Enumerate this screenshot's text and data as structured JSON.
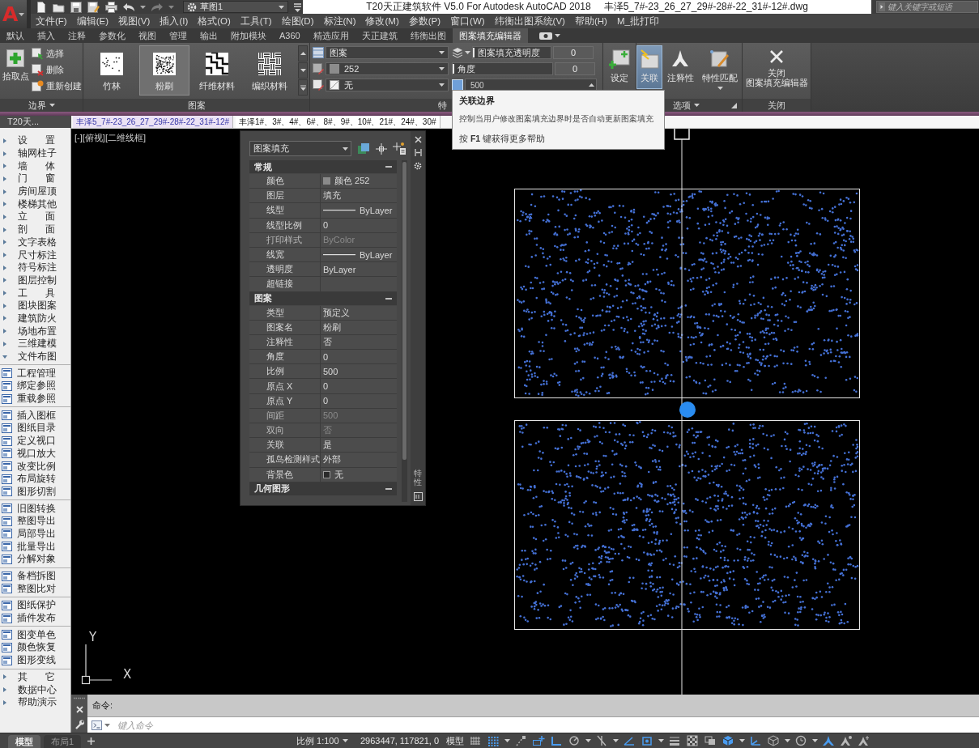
{
  "app_logo": "A",
  "workspace": "草图1",
  "window_title": "T20天正建筑软件 V5.0 For Autodesk AutoCAD 2018",
  "document_name": "丰泽5_7#-23_26_27_29#-28#-22_31#-12#.dwg",
  "search": {
    "placeholder": "键入关键字或短语"
  },
  "menu": [
    "文件(F)",
    "编辑(E)",
    "视图(V)",
    "插入(I)",
    "格式(O)",
    "工具(T)",
    "绘图(D)",
    "标注(N)",
    "修改(M)",
    "参数(P)",
    "窗口(W)",
    "纬衡出图系统(V)",
    "帮助(H)",
    "M_批打印"
  ],
  "ribbon_tabs": [
    {
      "label": "默认",
      "selected": false
    },
    {
      "label": "插入",
      "selected": false
    },
    {
      "label": "注释",
      "selected": false
    },
    {
      "label": "参数化",
      "selected": false
    },
    {
      "label": "视图",
      "selected": false
    },
    {
      "label": "管理",
      "selected": false
    },
    {
      "label": "输出",
      "selected": false
    },
    {
      "label": "附加模块",
      "selected": false
    },
    {
      "label": "A360",
      "selected": false
    },
    {
      "label": "精选应用",
      "selected": false
    },
    {
      "label": "天正建筑",
      "selected": false
    },
    {
      "label": "纬衡出图",
      "selected": false
    },
    {
      "label": "图案填充编辑器",
      "selected": true
    }
  ],
  "ribbon": {
    "boundary": {
      "title": "边界",
      "pick_points": "拾取点",
      "tools": [
        "选择",
        "删除",
        "重新创建"
      ]
    },
    "pattern": {
      "title": "图案",
      "patterns": [
        {
          "label": "竹林",
          "kind": "dots",
          "selected": false
        },
        {
          "label": "粉刷",
          "kind": "stipple",
          "selected": true
        },
        {
          "label": "纤维材料",
          "kind": "steps",
          "selected": false
        },
        {
          "label": "编织材料",
          "kind": "weave",
          "selected": false
        }
      ]
    },
    "properties": {
      "title": "特",
      "hatch_type": "图案",
      "hatch_color": "252",
      "background_color": "无",
      "transparency": {
        "label": "图案填充透明度",
        "value": "0",
        "level": 0
      },
      "angle": {
        "label": "角度",
        "value": "0",
        "level": 0
      },
      "scale": "500"
    },
    "origin": {
      "button": "设定"
    },
    "options": {
      "title": "选项",
      "buttons": [
        {
          "label": "关联",
          "kind": "associative",
          "selected": true
        },
        {
          "label": "注释性",
          "kind": "annotative",
          "selected": false
        },
        {
          "label": "特性匹配",
          "kind": "match",
          "selected": false
        }
      ]
    },
    "close": {
      "title": "关闭",
      "button_lines": [
        "关闭",
        "图案填充编辑器"
      ]
    }
  },
  "tooltip": {
    "title": "关联边界",
    "description": "控制当用户修改图案填充边界时是否自动更新图案填充",
    "help": "按 **F1** 键获得更多帮助"
  },
  "file_tabs": [
    {
      "label": "丰泽5_7#-23_26_27_29#-28#-22_31#-12#",
      "selected": true
    },
    {
      "label": "丰泽1#、3#、4#、6#、8#、9#、10#、21#、24#、30#",
      "selected": false
    }
  ],
  "sidebar": {
    "title": "T20天...",
    "items": [
      {
        "label": "设 置",
        "expanded": false
      },
      {
        "label": "轴网柱子",
        "expanded": false
      },
      {
        "label": "墙 体",
        "expanded": false
      },
      {
        "label": "门 窗",
        "expanded": false
      },
      {
        "label": "房间屋顶",
        "expanded": false
      },
      {
        "label": "楼梯其他",
        "expanded": false
      },
      {
        "label": "立 面",
        "expanded": false
      },
      {
        "label": "剖 面",
        "expanded": false
      },
      {
        "label": "文字表格",
        "expanded": false
      },
      {
        "label": "尺寸标注",
        "expanded": false
      },
      {
        "label": "符号标注",
        "expanded": false
      },
      {
        "label": "图层控制",
        "expanded": false
      },
      {
        "label": "工 具",
        "expanded": false
      },
      {
        "label": "图块图案",
        "expanded": false
      },
      {
        "label": "建筑防火",
        "expanded": false
      },
      {
        "label": "场地布置",
        "expanded": false
      },
      {
        "label": "三维建模",
        "expanded": false
      },
      {
        "label": "文件布图",
        "expanded": true,
        "children": [
          {
            "items": [
              {
                "label": "工程管理"
              },
              {
                "label": "绑定参照"
              },
              {
                "label": "重载参照"
              }
            ]
          },
          {
            "items": [
              {
                "label": "插入图框"
              },
              {
                "label": "图纸目录"
              },
              {
                "label": "定义视口"
              },
              {
                "label": "视口放大"
              },
              {
                "label": "改变比例"
              },
              {
                "label": "布局旋转"
              },
              {
                "label": "图形切割"
              }
            ]
          },
          {
            "items": [
              {
                "label": "旧图转换"
              },
              {
                "label": "整图导出"
              },
              {
                "label": "局部导出"
              },
              {
                "label": "批量导出"
              },
              {
                "label": "分解对象"
              }
            ]
          },
          {
            "items": [
              {
                "label": "备档拆图"
              },
              {
                "label": "整图比对"
              }
            ]
          },
          {
            "items": [
              {
                "label": "图纸保护"
              },
              {
                "label": "插件发布"
              }
            ]
          },
          {
            "items": [
              {
                "label": "图变单色"
              },
              {
                "label": "颜色恢复"
              },
              {
                "label": "图形变线"
              }
            ]
          }
        ]
      },
      {
        "label": "其 它",
        "expanded": false
      },
      {
        "label": "数据中心",
        "expanded": false
      },
      {
        "label": "帮助演示",
        "expanded": false
      }
    ]
  },
  "viewport": {
    "label": "[-][俯视][二维线框]",
    "ucs_y": "Y",
    "ucs_x": "X"
  },
  "properties_palette": {
    "object_type": "图案填充",
    "side_label": "特性",
    "sections": [
      {
        "title": "常规",
        "expanded": true,
        "rows": [
          {
            "label": "颜色",
            "value": "颜色 252",
            "kind": "swatch",
            "color": "#8a8a8a",
            "disabled": false
          },
          {
            "label": "图层",
            "value": "填充",
            "kind": "text",
            "disabled": false
          },
          {
            "label": "线型",
            "value": "ByLayer",
            "kind": "line",
            "disabled": false
          },
          {
            "label": "线型比例",
            "value": "0",
            "kind": "text",
            "disabled": false
          },
          {
            "label": "打印样式",
            "value": "ByColor",
            "kind": "text",
            "disabled": true
          },
          {
            "label": "线宽",
            "value": "ByLayer",
            "kind": "line",
            "disabled": false
          },
          {
            "label": "透明度",
            "value": "ByLayer",
            "kind": "text",
            "disabled": false
          },
          {
            "label": "超链接",
            "kind": "text",
            "disabled": false
          }
        ]
      },
      {
        "title": "图案",
        "expanded": true,
        "rows": [
          {
            "label": "类型",
            "value": "预定义",
            "kind": "text",
            "disabled": false
          },
          {
            "label": "图案名",
            "value": "粉刷",
            "kind": "text",
            "disabled": false
          },
          {
            "label": "注释性",
            "value": "否",
            "kind": "text",
            "disabled": false
          },
          {
            "label": "角度",
            "value": "0",
            "kind": "text",
            "disabled": false
          },
          {
            "label": "比例",
            "value": "500",
            "kind": "text",
            "disabled": false
          },
          {
            "label": "原点 X",
            "value": "0",
            "kind": "text",
            "disabled": false
          },
          {
            "label": "原点 Y",
            "value": "0",
            "kind": "text",
            "disabled": false
          },
          {
            "label": "间距",
            "value": "500",
            "kind": "text",
            "disabled": true
          },
          {
            "label": "双向",
            "value": "否",
            "kind": "text",
            "disabled": true
          },
          {
            "label": "关联",
            "value": "是",
            "kind": "text",
            "disabled": false
          },
          {
            "label": "孤岛检测样式",
            "value": "外部",
            "kind": "text",
            "disabled": false
          },
          {
            "label": "背景色",
            "value": "无",
            "kind": "swatch",
            "disabled": false
          }
        ]
      },
      {
        "title": "几何图形",
        "expanded": true
      }
    ]
  },
  "command_line": {
    "history": "命令:",
    "placeholder": "键入命令"
  },
  "layout_tabs": [
    {
      "label": "模型",
      "selected": true
    },
    {
      "label": "布局1",
      "selected": false
    }
  ],
  "status_bar": {
    "scale": "比例 1:100",
    "coordinates": "2963447, 117821, 0",
    "space": "模型",
    "toggles": [
      {
        "kind": "grid",
        "on": false
      },
      {
        "kind": "snap",
        "on": true
      },
      {
        "kind": "infer",
        "on": false
      },
      {
        "kind": "dyninput",
        "on": true
      },
      {
        "kind": "ortho",
        "on": true
      },
      {
        "kind": "polar",
        "on": false
      },
      {
        "kind": "iso",
        "on": false
      },
      {
        "kind": "tracking",
        "on": true
      },
      {
        "kind": "osnap",
        "on": true
      },
      {
        "kind": "lineweight",
        "on": false
      },
      {
        "kind": "transparency",
        "on": false
      },
      {
        "kind": "cycling",
        "on": false
      },
      {
        "kind": "snap3d",
        "on": true
      },
      {
        "kind": "dynucs",
        "on": true
      },
      {
        "kind": "filter",
        "on": false
      },
      {
        "kind": "gizmo",
        "on": false
      },
      {
        "kind": "annotation",
        "on": true
      },
      {
        "kind": "annovis",
        "on": false
      },
      {
        "kind": "autoscale",
        "on": false
      }
    ]
  }
}
